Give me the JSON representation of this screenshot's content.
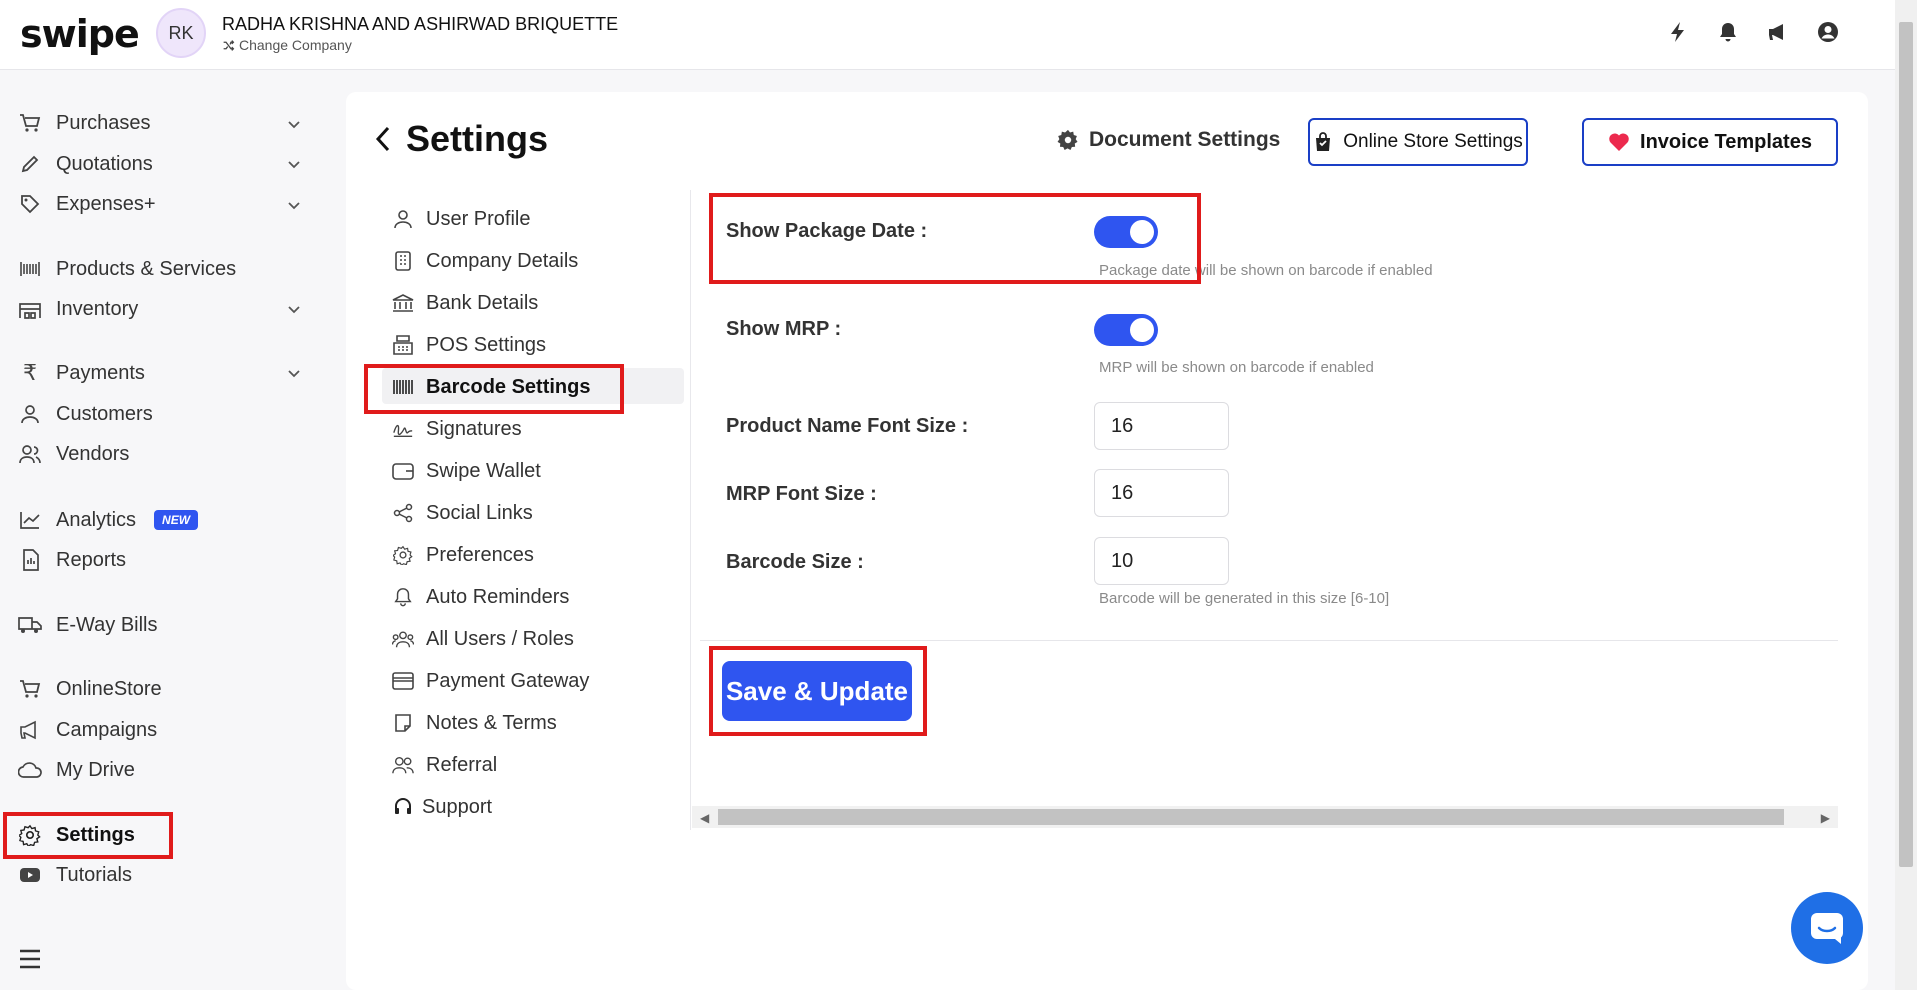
{
  "app": {
    "logo": "swipe"
  },
  "company": {
    "initials": "RK",
    "name": "RADHA KRISHNA AND ASHIRWAD BRIQUETTE",
    "change_label": "Change Company"
  },
  "sidebar": {
    "items": [
      {
        "label": "Purchases",
        "icon": "cart-icon",
        "chevron": true
      },
      {
        "label": "Quotations",
        "icon": "pen-icon",
        "chevron": true
      },
      {
        "label": "Expenses+",
        "icon": "tag-icon",
        "chevron": true
      },
      {
        "label": "Products & Services",
        "icon": "barcode-icon",
        "chevron": false
      },
      {
        "label": "Inventory",
        "icon": "warehouse-icon",
        "chevron": true
      },
      {
        "label": "Payments",
        "icon": "rupee-icon",
        "chevron": true
      },
      {
        "label": "Customers",
        "icon": "user-icon",
        "chevron": false
      },
      {
        "label": "Vendors",
        "icon": "users-icon",
        "chevron": false
      },
      {
        "label": "Analytics",
        "icon": "chart-icon",
        "chevron": false,
        "badge": "NEW"
      },
      {
        "label": "Reports",
        "icon": "report-icon",
        "chevron": false
      },
      {
        "label": "E-Way Bills",
        "icon": "truck-icon",
        "chevron": false
      },
      {
        "label": "OnlineStore",
        "icon": "store-icon",
        "chevron": false
      },
      {
        "label": "Campaigns",
        "icon": "megaphone-icon",
        "chevron": false
      },
      {
        "label": "My Drive",
        "icon": "cloud-icon",
        "chevron": false
      },
      {
        "label": "Settings",
        "icon": "gear-icon",
        "chevron": false,
        "active": true
      },
      {
        "label": "Tutorials",
        "icon": "youtube-icon",
        "chevron": false
      }
    ]
  },
  "page": {
    "title": "Settings",
    "doc_settings_label": "Document Settings",
    "online_store_label": "Online Store Settings",
    "invoice_templates_label": "Invoice Templates"
  },
  "settings_nav": {
    "items": [
      {
        "label": "User Profile",
        "icon": "user-icon"
      },
      {
        "label": "Company Details",
        "icon": "building-icon"
      },
      {
        "label": "Bank Details",
        "icon": "bank-icon"
      },
      {
        "label": "POS Settings",
        "icon": "pos-icon"
      },
      {
        "label": "Barcode Settings",
        "icon": "barcode-icon",
        "active": true
      },
      {
        "label": "Signatures",
        "icon": "signature-icon"
      },
      {
        "label": "Swipe Wallet",
        "icon": "wallet-icon"
      },
      {
        "label": "Social Links",
        "icon": "share-icon"
      },
      {
        "label": "Preferences",
        "icon": "gear-icon"
      },
      {
        "label": "Auto Reminders",
        "icon": "bell-icon"
      },
      {
        "label": "All Users / Roles",
        "icon": "users-icon"
      },
      {
        "label": "Payment Gateway",
        "icon": "card-icon"
      },
      {
        "label": "Notes & Terms",
        "icon": "note-icon"
      },
      {
        "label": "Referral",
        "icon": "users-icon"
      },
      {
        "label": "Support",
        "icon": "headset-icon"
      }
    ]
  },
  "form": {
    "show_package_date": {
      "label": "Show Package Date :",
      "enabled": true,
      "hint": "Package date will be shown on barcode if enabled"
    },
    "show_mrp": {
      "label": "Show MRP :",
      "enabled": true,
      "hint": "MRP will be shown on barcode if enabled"
    },
    "product_name_font_size": {
      "label": "Product Name Font Size :",
      "value": "16"
    },
    "mrp_font_size": {
      "label": "MRP Font Size :",
      "value": "16"
    },
    "barcode_size": {
      "label": "Barcode Size :",
      "value": "10",
      "hint": "Barcode will be generated in this size [6-10]"
    },
    "save_label": "Save & Update"
  },
  "colors": {
    "accent": "#2f55f0",
    "highlight": "#e01b1b",
    "button_border": "#1a3fc6"
  }
}
